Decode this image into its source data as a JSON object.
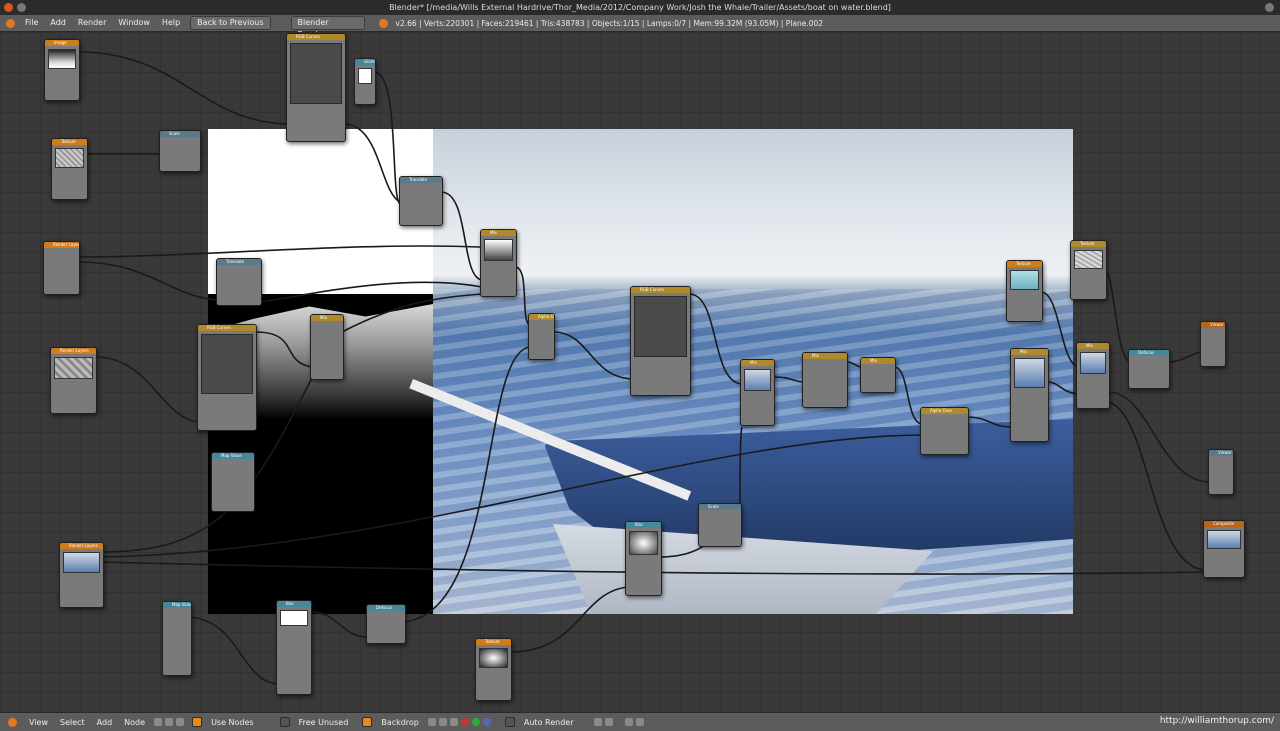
{
  "window": {
    "title": "Blender* [/media/Wills External Hardrive/Thor_Media/2012/Company Work/Josh the Whale/Trailer/Assets/boat on water.blend]"
  },
  "menubar": {
    "items": [
      "File",
      "Add",
      "Render",
      "Window",
      "Help"
    ],
    "back_button": "Back to Previous",
    "render_engine": "Blender Render",
    "stats": "v2.66 | Verts:220301 | Faces:219461 | Tris:438783 | Objects:1/15 | Lamps:0/7 | Mem:99.32M (93.05M) | Plane.002"
  },
  "statusbar": {
    "items": [
      "View",
      "Select",
      "Add",
      "Node"
    ],
    "use_nodes": "Use Nodes",
    "free_unused": "Free Unused",
    "backdrop": "Backdrop",
    "auto_render": "Auto Render",
    "credit": "http://williamthorup.com/"
  },
  "nodes": [
    {
      "label": "Image",
      "kind": "in"
    },
    {
      "label": "RGB Curves",
      "kind": "col"
    },
    {
      "label": "Glare",
      "kind": "conv"
    },
    {
      "label": "Texture",
      "kind": "in"
    },
    {
      "label": "Scale",
      "kind": "dist"
    },
    {
      "label": "Translate",
      "kind": "dist"
    },
    {
      "label": "Render Layers",
      "kind": "in"
    },
    {
      "label": "Render Layers",
      "kind": "in"
    },
    {
      "label": "Mix",
      "kind": "col"
    },
    {
      "label": "RGB Curves",
      "kind": "col"
    },
    {
      "label": "Alpha Over",
      "kind": "col"
    },
    {
      "label": "Blur",
      "kind": "conv"
    },
    {
      "label": "Viewer",
      "kind": "out"
    },
    {
      "label": "Composite",
      "kind": "out"
    },
    {
      "label": "Texture",
      "kind": "in"
    },
    {
      "label": "Map Value",
      "kind": "conv"
    },
    {
      "label": "Defocus",
      "kind": "conv"
    }
  ]
}
